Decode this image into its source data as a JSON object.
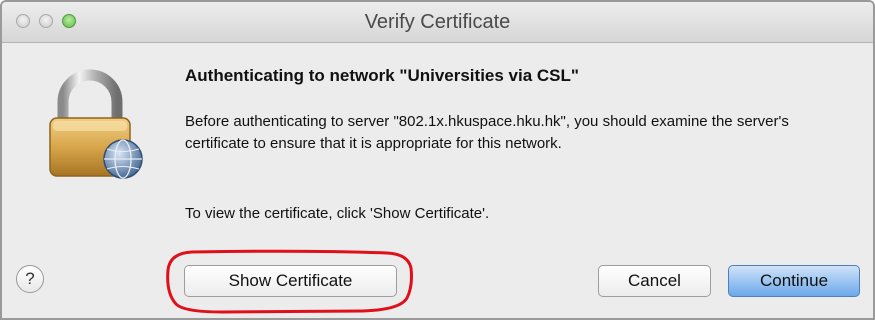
{
  "window": {
    "title": "Verify Certificate"
  },
  "dialog": {
    "heading": "Authenticating to network \"Universities via CSL\"",
    "body": "Before authenticating to server \"802.1x.hkuspace.hku.hk\", you should examine the server's certificate to ensure that it is appropriate for this network.",
    "hint": "To view the certificate, click 'Show Certificate'.",
    "icon": "lock-icon"
  },
  "buttons": {
    "help": "?",
    "show_certificate": "Show Certificate",
    "cancel": "Cancel",
    "continue": "Continue"
  },
  "colors": {
    "default_button": "#6ba8ea",
    "annotation": "#e0101a"
  }
}
